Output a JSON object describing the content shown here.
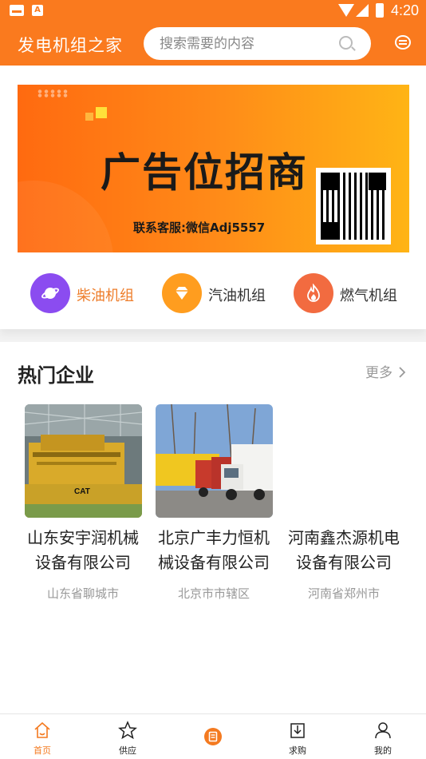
{
  "status_bar": {
    "time": "4:20",
    "icon_a": "A"
  },
  "header": {
    "title": "发电机组之家",
    "search_placeholder": "搜索需要的内容"
  },
  "banner": {
    "title": "广告位招商",
    "contact": "联系客服:微信Adj5557"
  },
  "categories": [
    {
      "label": "柴油机组",
      "icon": "planet-icon",
      "color": "#8b4cf0"
    },
    {
      "label": "汽油机组",
      "icon": "diamond-icon",
      "color": "#ff9d1f"
    },
    {
      "label": "燃气机组",
      "icon": "flame-icon",
      "color": "#f26b40"
    }
  ],
  "hot_section": {
    "title": "热门企业",
    "more_label": "更多",
    "companies": [
      {
        "name_line1": "山东安宇润机械",
        "name_line2": "设备有限公司",
        "city": "山东省聊城市"
      },
      {
        "name_line1": "北京广丰力恒机",
        "name_line2": "械设备有限公司",
        "city": "北京市市辖区"
      },
      {
        "name_line1": "河南鑫杰源机电",
        "name_line2": "设备有限公司",
        "city": "河南省郑州市"
      }
    ]
  },
  "bottom_nav": [
    {
      "label": "首页",
      "icon": "home-icon",
      "active": true
    },
    {
      "label": "供应",
      "icon": "star-icon"
    },
    {
      "label": "",
      "icon": "document-icon"
    },
    {
      "label": "求购",
      "icon": "download-icon"
    },
    {
      "label": "我的",
      "icon": "user-icon"
    }
  ],
  "colors": {
    "accent": "#fa7a1e",
    "active_tab": "#f47a20"
  }
}
